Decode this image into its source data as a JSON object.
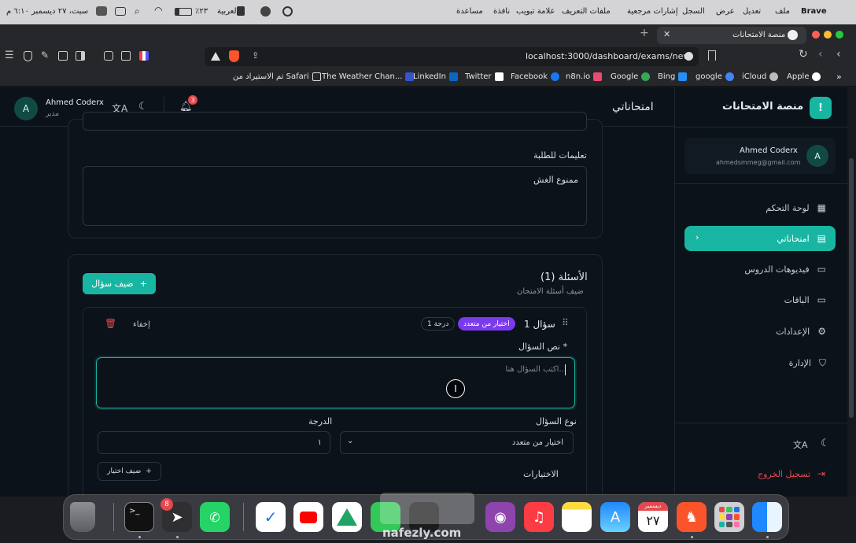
{
  "menubar": {
    "datetime": "سبت، ٢٧ ديسمبر ٦:١٠ م",
    "language": "العربية",
    "battery": "٪٢٣",
    "items": [
      "Brave",
      "ملف",
      "تعديل",
      "عرض",
      "السجل",
      "إشارات مرجعية",
      "ملفات التعريف",
      "علامة تبويب",
      "نافذة",
      "مساعدة"
    ]
  },
  "browser": {
    "tab_title": "منصة الامتحانات",
    "url": "localhost:3000/dashboard/exams/new",
    "bookmarks": [
      "Apple",
      "iCloud",
      "google",
      "Bing",
      "Google",
      "n8n.io",
      "Facebook",
      "Twitter",
      "LinkedIn",
      "The Weather Chan...",
      "تم الاستيراد من Safari"
    ],
    "bookmark_colors": [
      "#ffffff",
      "#bbbbbb",
      "#4285f4",
      "#258ffa",
      "#34a853",
      "#ea4b71",
      "#1877f2",
      "#ffffff",
      "#0a66c2",
      "#3355cc",
      "#d9d9d9"
    ]
  },
  "sidebar": {
    "brand": "منصة الامتحانات",
    "brand_icon": "!",
    "user_name": "Ahmed Coderx",
    "user_email": "ahmedsmmeg@gmail.com",
    "avatar": "A",
    "nav": [
      {
        "label": "لوحة التحكم",
        "icon": "grid-icon"
      },
      {
        "label": "امتحاناتي",
        "icon": "document-icon"
      },
      {
        "label": "فيديوهات الدروس",
        "icon": "video-icon"
      },
      {
        "label": "الباقات",
        "icon": "card-icon"
      },
      {
        "label": "الإعدادات",
        "icon": "gear-icon"
      },
      {
        "label": "الإدارة",
        "icon": "shield-icon"
      }
    ],
    "logout": "تسجيل الخروج"
  },
  "header": {
    "title": "امتحاناتي",
    "user_name": "Ahmed Coderx",
    "user_role": "مدير",
    "avatar": "A",
    "notifications": "3"
  },
  "instructions": {
    "label": "تعليمات للطلبة",
    "value": "ممنوع الغش"
  },
  "questions": {
    "title": "الأسئلة (1)",
    "subtitle": "ضيف أسئلة الامتحان",
    "add_button": "ضيف سؤال",
    "question": {
      "title": "سؤال 1",
      "type_badge": "اختيار من متعدد",
      "points_badge": "1 درجة",
      "hide": "إخفاء",
      "text_label": "نص السؤال *",
      "text_placeholder": "اكتب السؤال هنا...",
      "type_label": "نوع السؤال",
      "type_value": "اختيار من متعدد",
      "points_label": "الدرجة",
      "points_value": "١",
      "choices_label": "الاختيارات",
      "add_choice": "ضيف اختيار"
    }
  },
  "dock": {
    "telegram_badge": "8",
    "calendar_month": "ديسمبر",
    "calendar_day": "٢٧"
  },
  "watermark": {
    "text": "nafezly.com"
  },
  "colors": {
    "accent": "#18b6a2",
    "danger": "#e5484d",
    "purple": "#7c3aed"
  }
}
